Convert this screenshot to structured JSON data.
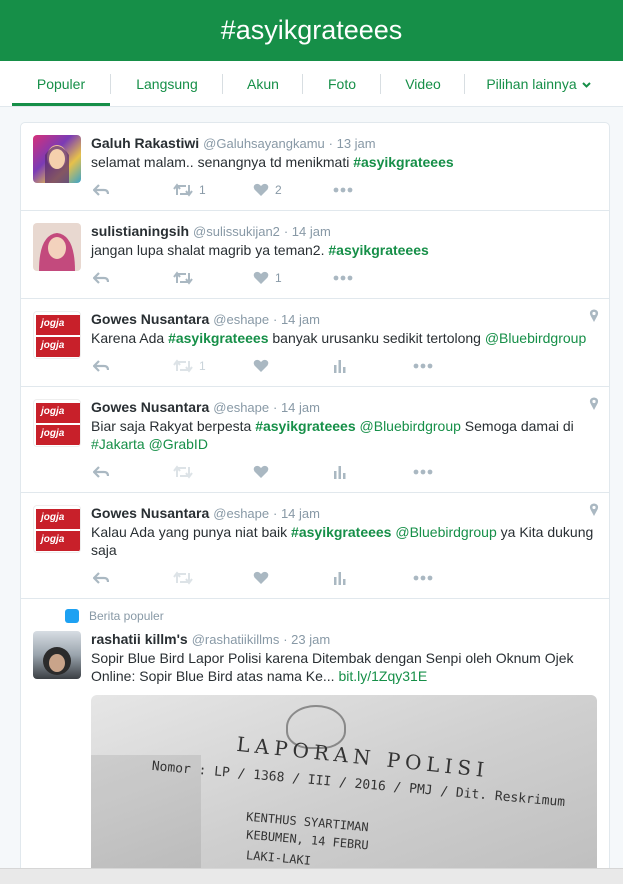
{
  "header": {
    "title": "#asyikgrateees"
  },
  "tabs": [
    {
      "label": "Populer"
    },
    {
      "label": "Langsung"
    },
    {
      "label": "Akun"
    },
    {
      "label": "Foto"
    },
    {
      "label": "Video"
    },
    {
      "label": "Pilihan lainnya"
    }
  ],
  "colors": {
    "brand": "#168f48",
    "muted": "#8899a6",
    "icon": "#aab8c2"
  },
  "tweets": [
    {
      "name": "Galuh Rakastiwi",
      "handle": "@Galuhsayangkamu",
      "time": "· 13 jam",
      "text_pre": "selamat malam.. senangnya td menikmati ",
      "tag": "#asyikgrateees",
      "text_post": "",
      "retweets": "1",
      "likes": "2"
    },
    {
      "name": "sulistianingsih",
      "handle": "@sulissukijan2",
      "time": "· 14 jam",
      "text_pre": "jangan lupa shalat magrib ya teman2. ",
      "tag": "#asyikgrateees",
      "text_post": "",
      "retweets": "",
      "likes": "1"
    },
    {
      "name": "Gowes Nusantara",
      "handle": "@eshape",
      "time": "· 14 jam",
      "text_pre": "Karena Ada ",
      "tag": "#asyikgrateees",
      "text_mid": " banyak urusanku sedikit tertolong ",
      "mention": "@Bluebirdgroup",
      "retweets": "1",
      "likes": ""
    },
    {
      "name": "Gowes Nusantara",
      "handle": "@eshape",
      "time": "· 14 jam",
      "text_pre": "Biar saja Rakyat berpesta ",
      "tag": "#asyikgrateees",
      "text_mid": " ",
      "mention": "@Bluebirdgroup",
      "text_after": " Semoga damai di ",
      "tag2": "#Jakarta",
      "text_sp": " ",
      "mention2": "@GrabID",
      "retweets": "",
      "likes": ""
    },
    {
      "name": "Gowes Nusantara",
      "handle": "@eshape",
      "time": "· 14 jam",
      "text_pre": "Kalau Ada yang punya niat baik ",
      "tag": "#asyikgrateees",
      "text_mid": " ",
      "mention": "@Bluebirdgroup",
      "text_after": " ya Kita dukung saja",
      "retweets": "",
      "likes": ""
    },
    {
      "context": "Berita populer",
      "name": "rashatii killm's",
      "handle": "@rashatiikillms",
      "time": "· 23 jam",
      "text_pre": "Sopir Blue Bird Lapor Polisi karena Ditembak dengan Senpi oleh Oknum Ojek Online: Sopir Blue Bird atas nama Ke... ",
      "link": "bit.ly/1Zqy31E"
    }
  ],
  "avatar_badge": "jogja",
  "photo_text": {
    "title": "LAPORAN POLISI",
    "nomor": "Nomor : LP / 1368 / III / 2016 / PMJ / Dit. Reskrimum",
    "line1": "KENTHUS SYARTIMAN",
    "line2": "KEBUMEN, 14 FEBRU",
    "line3": "LAKI-LAKI"
  }
}
